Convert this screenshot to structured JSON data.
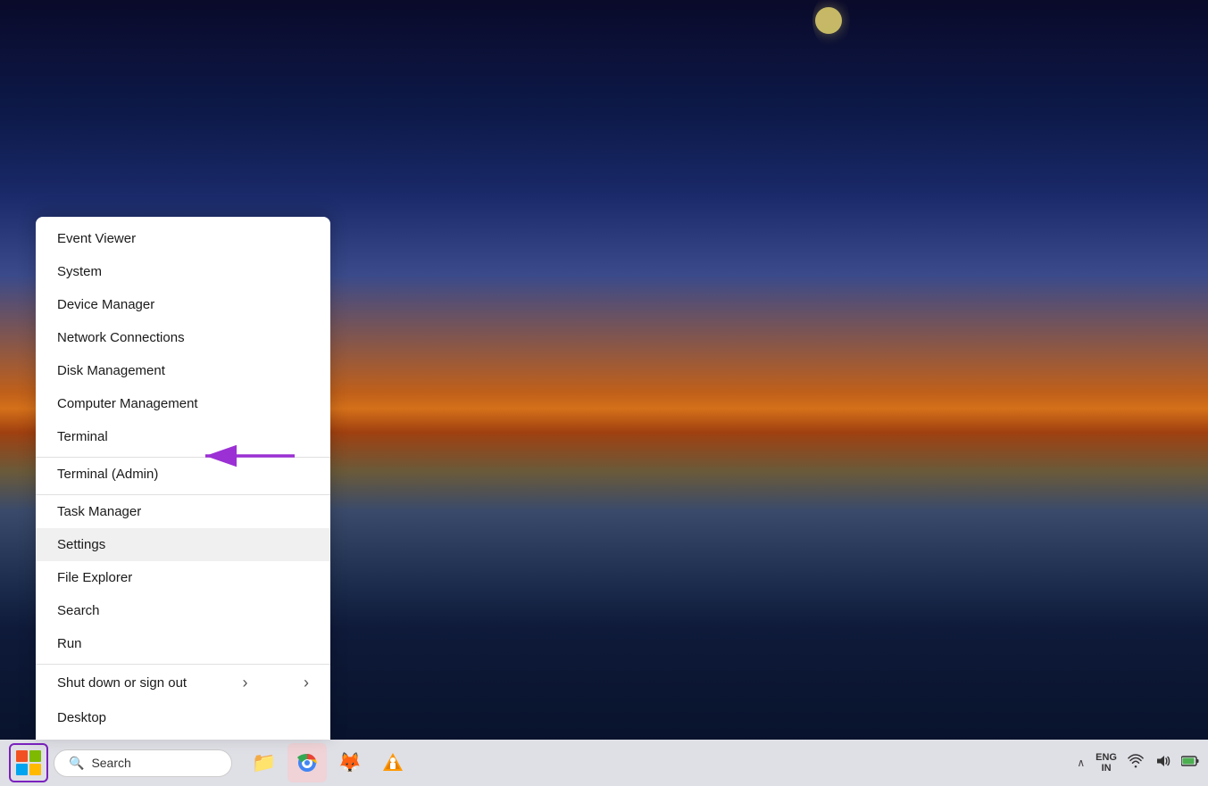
{
  "desktop": {
    "background_desc": "Winter landscape at dusk with snow-covered fields and orange horizon"
  },
  "context_menu": {
    "items": [
      {
        "label": "Event Viewer",
        "has_arrow": false,
        "separator_above": false,
        "highlighted": false
      },
      {
        "label": "System",
        "has_arrow": false,
        "separator_above": false,
        "highlighted": false
      },
      {
        "label": "Device Manager",
        "has_arrow": false,
        "separator_above": false,
        "highlighted": false
      },
      {
        "label": "Network Connections",
        "has_arrow": false,
        "separator_above": false,
        "highlighted": false
      },
      {
        "label": "Disk Management",
        "has_arrow": false,
        "separator_above": false,
        "highlighted": false
      },
      {
        "label": "Computer Management",
        "has_arrow": false,
        "separator_above": false,
        "highlighted": false
      },
      {
        "label": "Terminal",
        "has_arrow": false,
        "separator_above": false,
        "highlighted": false
      },
      {
        "label": "Terminal (Admin)",
        "has_arrow": false,
        "separator_above": true,
        "highlighted": false
      },
      {
        "label": "Task Manager",
        "has_arrow": false,
        "separator_above": true,
        "highlighted": false
      },
      {
        "label": "Settings",
        "has_arrow": false,
        "separator_above": false,
        "highlighted": true
      },
      {
        "label": "File Explorer",
        "has_arrow": false,
        "separator_above": false,
        "highlighted": false
      },
      {
        "label": "Search",
        "has_arrow": false,
        "separator_above": false,
        "highlighted": false
      },
      {
        "label": "Run",
        "has_arrow": false,
        "separator_above": false,
        "highlighted": false
      },
      {
        "label": "Shut down or sign out",
        "has_arrow": true,
        "separator_above": true,
        "highlighted": false
      },
      {
        "label": "Desktop",
        "has_arrow": false,
        "separator_above": false,
        "highlighted": false
      }
    ]
  },
  "taskbar": {
    "search_placeholder": "Search",
    "apps": [
      {
        "name": "file-explorer",
        "emoji": "🗂️"
      },
      {
        "name": "chrome",
        "emoji": "🌐"
      },
      {
        "name": "firefox",
        "emoji": "🦊"
      },
      {
        "name": "vlc",
        "emoji": "🔶"
      }
    ],
    "language": "ENG\nIN",
    "language_line1": "ENG",
    "language_line2": "IN"
  }
}
